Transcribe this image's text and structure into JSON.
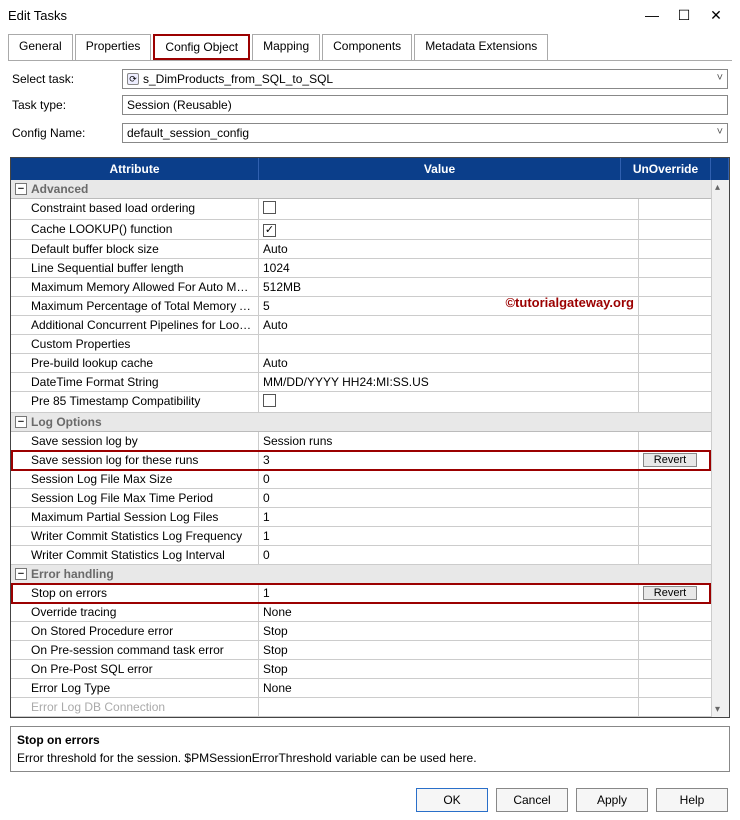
{
  "window": {
    "title": "Edit Tasks"
  },
  "tabs": [
    "General",
    "Properties",
    "Config Object",
    "Mapping",
    "Components",
    "Metadata Extensions"
  ],
  "form": {
    "selectTaskLabel": "Select task:",
    "selectTaskValue": "s_DimProducts_from_SQL_to_SQL",
    "taskTypeLabel": "Task type:",
    "taskTypeValue": "Session (Reusable)",
    "configNameLabel": "Config Name:",
    "configNameValue": "default_session_config"
  },
  "columns": {
    "attr": "Attribute",
    "val": "Value",
    "un": "UnOverride"
  },
  "groups": {
    "advanced": "Advanced",
    "log": "Log Options",
    "error": "Error handling"
  },
  "rows": {
    "advanced": [
      {
        "a": "Constraint based load ordering",
        "v": "[chk]"
      },
      {
        "a": "Cache LOOKUP() function",
        "v": "[chk-checked]"
      },
      {
        "a": "Default buffer block size",
        "v": "Auto"
      },
      {
        "a": "Line Sequential buffer length",
        "v": "1024"
      },
      {
        "a": "Maximum Memory Allowed For Auto Memory Attri...",
        "v": "512MB"
      },
      {
        "a": "Maximum Percentage of Total Memory Allowed F...",
        "v": "5"
      },
      {
        "a": "Additional Concurrent Pipelines for Lookup Cach...",
        "v": "Auto"
      },
      {
        "a": "Custom Properties",
        "v": ""
      },
      {
        "a": "Pre-build lookup cache",
        "v": "Auto"
      },
      {
        "a": "DateTime Format String",
        "v": "MM/DD/YYYY HH24:MI:SS.US"
      },
      {
        "a": "Pre 85 Timestamp Compatibility",
        "v": "[chk]"
      }
    ],
    "log": [
      {
        "a": "Save session log by",
        "v": "Session runs"
      },
      {
        "a": "Save session log for these runs",
        "v": "3",
        "revert": true
      },
      {
        "a": "Session Log File Max Size",
        "v": "0"
      },
      {
        "a": "Session Log File Max Time Period",
        "v": "0"
      },
      {
        "a": "Maximum Partial Session Log Files",
        "v": "1"
      },
      {
        "a": "Writer Commit Statistics Log Frequency",
        "v": "1"
      },
      {
        "a": "Writer Commit Statistics Log Interval",
        "v": "0"
      }
    ],
    "error": [
      {
        "a": "Stop on errors",
        "v": "1",
        "revert": true
      },
      {
        "a": "Override tracing",
        "v": "None"
      },
      {
        "a": "On Stored Procedure error",
        "v": "Stop"
      },
      {
        "a": "On Pre-session command task error",
        "v": "Stop"
      },
      {
        "a": "On Pre-Post SQL error",
        "v": "Stop"
      },
      {
        "a": "Error Log Type",
        "v": "None"
      },
      {
        "a": "Error Log DB Connection",
        "v": "",
        "disabled": true
      }
    ]
  },
  "watermark": "©tutorialgateway.org",
  "revertLabel": "Revert",
  "desc": {
    "title": "Stop on errors",
    "body": "Error threshold for the session. $PMSessionErrorThreshold variable can be used here."
  },
  "footer": {
    "ok": "OK",
    "cancel": "Cancel",
    "apply": "Apply",
    "help": "Help"
  }
}
